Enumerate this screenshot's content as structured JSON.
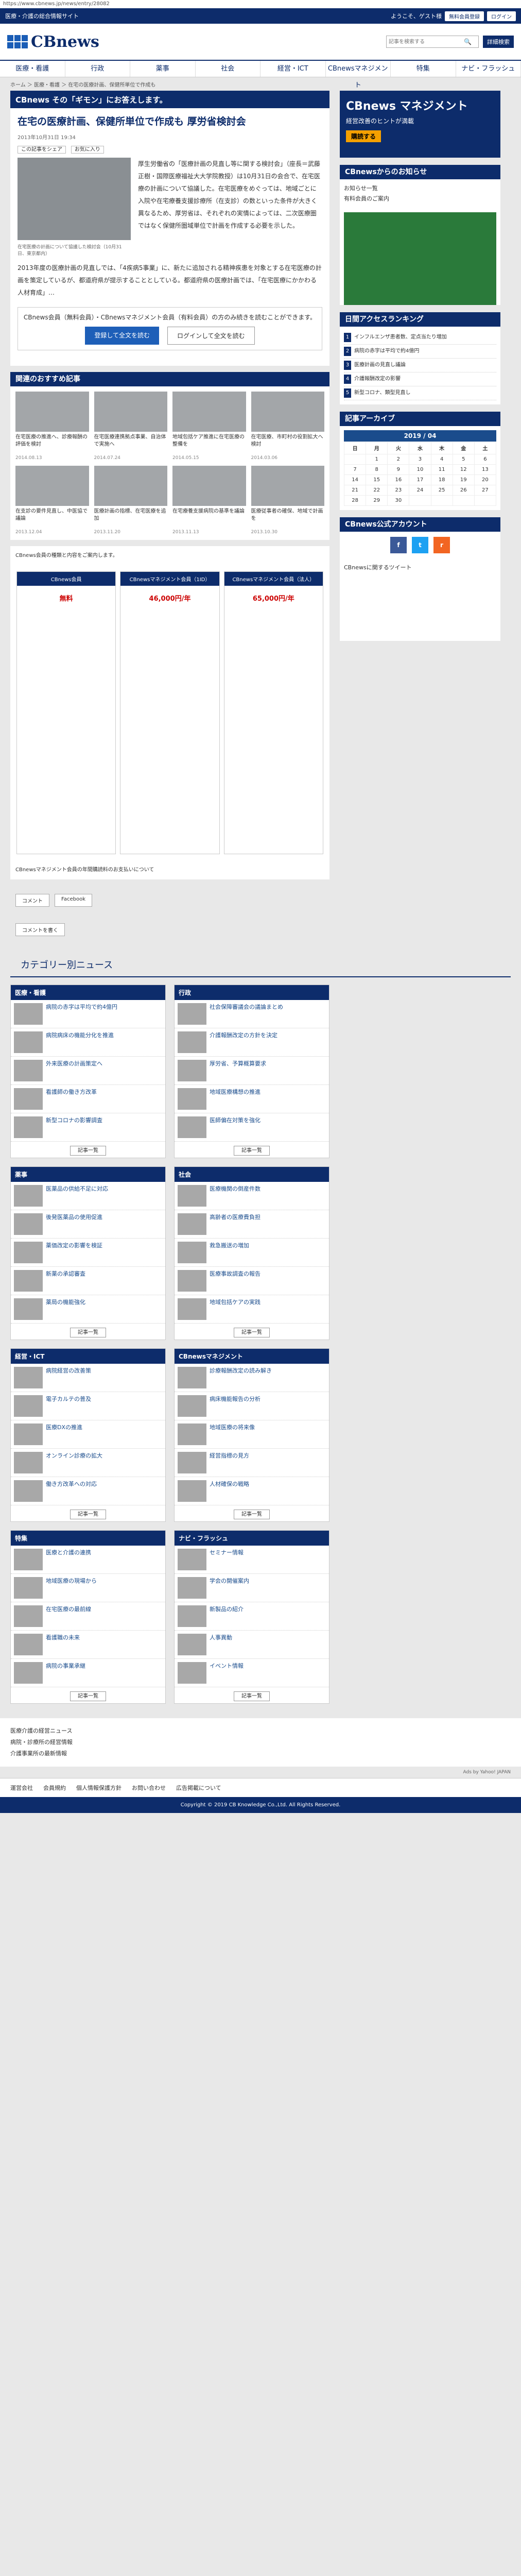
{
  "url": "https://www.cbnews.jp/news/entry/28082",
  "topbar": {
    "left": "医療・介護の総合情報サイト",
    "welcome": "ようこそ、ゲスト様",
    "reg": "無料会員登録",
    "login": "ログイン"
  },
  "brand": "CBnews",
  "search_placeholder": "記事を検索する",
  "detail_search": "詳細検索",
  "nav": [
    "医療・看護",
    "行政",
    "薬事",
    "社会",
    "経営・ICT",
    "CBnewsマネジメント",
    "特集",
    "ナビ・フラッシュ"
  ],
  "breadcrumb": "ホーム ＞ 医療・看護 ＞ 在宅の医療計画、保健所単位で作成も",
  "banner": "CBnews その「ギモン」にお答えします。",
  "article": {
    "title": "在宅の医療計画、保健所単位で作成も 厚労省検討会",
    "meta": "2013年10月31日 19:34",
    "tags": [
      "この記事をシェア",
      "お気に入り"
    ],
    "photo_caption": "在宅医療の計画について協議した検討会（10月31日、東京都内）",
    "body1": "厚生労働省の「医療計画の見直し等に関する検討会」（座長＝武藤正樹・国際医療福祉大大学院教授）は10月31日の会合で、在宅医療の計画について協議した。在宅医療をめぐっては、地域ごとに入院や在宅療養支援診療所（在支診）の数といった条件が大きく異なるため、厚労省は、それぞれの実情によっては、二次医療圏ではなく保健所圏域単位で計画を作成する必要を示した。",
    "body2": "2013年度の医療計画の見直しでは、「4疾病5事業」に、新たに追加される精神疾患を対象とする在宅医療の計画を策定しているが、都道府県が提示することとしている。都道府県の医療計画では、「在宅医療にかかわる人材育成」…",
    "pay_text": "CBnews会員（無料会員）・CBnewsマネジメント会員（有料会員）の方のみ続きを読むことができます。",
    "pay_btn1": "登録して全文を読む",
    "pay_btn2": "ログインして全文を読む"
  },
  "related": {
    "heading": "関連のおすすめ記事",
    "items": [
      {
        "title": "在宅医療の推進へ、診療報酬の評価を検討",
        "date": "2014.08.13"
      },
      {
        "title": "在宅医療連携拠点事業、自治体で実施へ",
        "date": "2014.07.24"
      },
      {
        "title": "地域包括ケア推進に在宅医療の整備を",
        "date": "2014.05.15"
      },
      {
        "title": "在宅医療、市町村の役割拡大へ検討",
        "date": "2014.03.06"
      },
      {
        "title": "在支診の要件見直し、中医協で議論",
        "date": "2013.12.04"
      },
      {
        "title": "医療計画の指標、在宅医療を追加",
        "date": "2013.11.20"
      },
      {
        "title": "在宅療養支援病院の基準を議論",
        "date": "2013.11.13"
      },
      {
        "title": "医療従事者の確保、地域で計画を",
        "date": "2013.10.30"
      }
    ]
  },
  "plans": {
    "intro": "CBnews会員の種類と内容をご案内します。",
    "cols": [
      {
        "name": "CBnews会員",
        "price": "無料"
      },
      {
        "name": "CBnewsマネジメント会員（1ID）",
        "price": "46,000円/年"
      },
      {
        "name": "CBnewsマネジメント会員（法人）",
        "price": "65,000円/年"
      }
    ],
    "notice": "CBnewsマネジメント会員の年間購読料のお支払いについて"
  },
  "social": {
    "comment": "コメント",
    "fb": "Facebook",
    "mark": "コメントを書く"
  },
  "categories_title": "カテゴリー別ニュース",
  "categories": [
    {
      "name": "医療・看護",
      "items": [
        "病院の赤字は平均で約4億円",
        "病院病床の機能分化を推進",
        "外来医療の計画策定へ",
        "看護師の働き方改革",
        "新型コロナの影響調査"
      ]
    },
    {
      "name": "行政",
      "items": [
        "社会保障審議会の議論まとめ",
        "介護報酬改定の方針を決定",
        "厚労省、予算概算要求",
        "地域医療構想の推進",
        "医師偏在対策を強化"
      ]
    },
    {
      "name": "薬事",
      "items": [
        "医薬品の供給不足に対応",
        "後発医薬品の使用促進",
        "薬価改定の影響を検証",
        "新薬の承認審査",
        "薬局の機能強化"
      ]
    },
    {
      "name": "社会",
      "items": [
        "医療機関の倒産件数",
        "高齢者の医療費負担",
        "救急搬送の増加",
        "医療事故調査の報告",
        "地域包括ケアの実践"
      ]
    },
    {
      "name": "経営・ICT",
      "items": [
        "病院経営の改善策",
        "電子カルテの普及",
        "医療DXの推進",
        "オンライン診療の拡大",
        "働き方改革への対応"
      ]
    },
    {
      "name": "CBnewsマネジメント",
      "items": [
        "診療報酬改定の読み解き",
        "病床機能報告の分析",
        "地域医療の将来像",
        "経営指標の見方",
        "人材確保の戦略"
      ]
    },
    {
      "name": "特集",
      "items": [
        "医療と介護の連携",
        "地域医療の現場から",
        "在宅医療の最前線",
        "看護職の未来",
        "病院の事業承継"
      ]
    },
    {
      "name": "ナビ・フラッシュ",
      "items": [
        "セミナー情報",
        "学会の開催案内",
        "新製品の紹介",
        "人事異動",
        "イベント情報"
      ]
    }
  ],
  "right": {
    "ad_title": "CBnews マネジメント",
    "ad_sub": "経営改善のヒントが満載",
    "ad_btn": "購読する",
    "info_head": "CBnewsからのお知らせ",
    "info": [
      "お知らせ一覧",
      "有料会員のご案内"
    ],
    "rank_head": "日間アクセスランキング",
    "rank": [
      "インフルエンザ患者数、定点当たり増加",
      "病院の赤字は平均で約4億円",
      "医療計画の見直し議論",
      "介護報酬改定の影響",
      "新型コロナ、類型見直し"
    ],
    "cal_head": "記事アーカイブ",
    "cal_month": "2019 / 04",
    "cal_days": [
      "日",
      "月",
      "火",
      "水",
      "木",
      "金",
      "土"
    ],
    "social_head": "CBnews公式アカウント",
    "tw_text": "CBnewsに関するツイート"
  },
  "footer": {
    "links": [
      "医療介護の経営ニュース",
      "病院・診療所の経営情報",
      "介護事業所の最新情報"
    ],
    "nav": [
      "運営会社",
      "会員規約",
      "個人情報保護方針",
      "お問い合わせ",
      "広告掲載について"
    ],
    "copy": "Copyright © 2019 CB Knowledge Co.,Ltd. All Rights Reserved."
  }
}
